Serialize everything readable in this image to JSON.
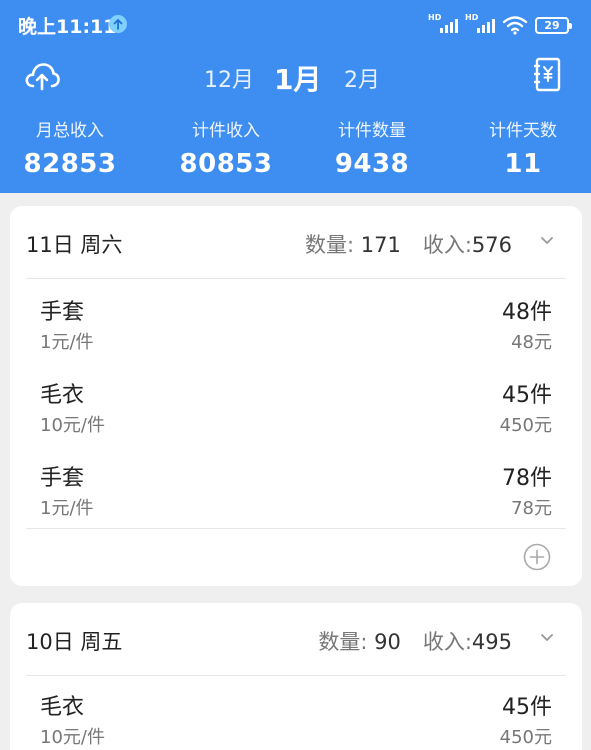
{
  "status_bar": {
    "time": "晚上11:11",
    "hd_1": "HD",
    "hd_2": "HD",
    "battery": "29"
  },
  "header": {
    "months": {
      "prev": "12月",
      "current": "1月",
      "next": "2月"
    },
    "stats": [
      {
        "label": "月总收入",
        "value": "82853"
      },
      {
        "label": "计件收入",
        "value": "80853"
      },
      {
        "label": "计件数量",
        "value": "9438"
      },
      {
        "label": "计件天数",
        "value": "11"
      }
    ]
  },
  "days": [
    {
      "date": "11日 周六",
      "qty_label": "数量:",
      "qty": "171",
      "income_label": "收入:",
      "income": "576",
      "items": [
        {
          "name": "手套",
          "price": "1元/件",
          "count": "48件",
          "amount": "48元"
        },
        {
          "name": "毛衣",
          "price": "10元/件",
          "count": "45件",
          "amount": "450元"
        },
        {
          "name": "手套",
          "price": "1元/件",
          "count": "78件",
          "amount": "78元"
        }
      ]
    },
    {
      "date": "10日 周五",
      "qty_label": "数量:",
      "qty": "90",
      "income_label": "收入:",
      "income": "495",
      "items": [
        {
          "name": "毛衣",
          "price": "10元/件",
          "count": "45件",
          "amount": "450元"
        }
      ]
    }
  ],
  "colors": {
    "header_bg": "#3d8ef0",
    "page_bg": "#efefef",
    "card_bg": "#ffffff",
    "text_primary": "#222222",
    "text_secondary": "#777777"
  }
}
